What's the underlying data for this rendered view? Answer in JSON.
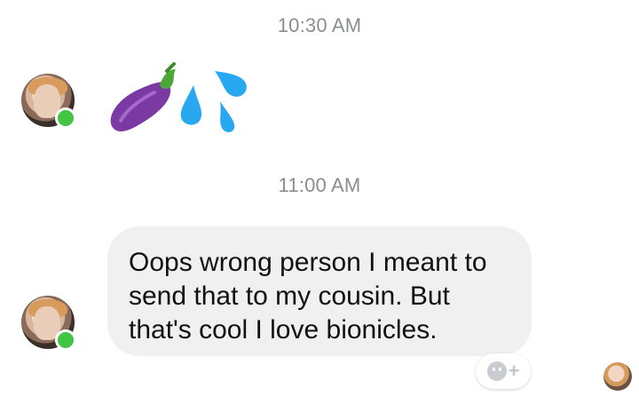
{
  "messages": {
    "time_1": "10:30 AM",
    "time_2": "11:00 AM",
    "message_2_text": "Oops wrong person I meant to send that to my cousin. But that's cool I love bionicles."
  },
  "emoji_message": {
    "icons": [
      "eggplant-icon",
      "sweat-droplets-icon"
    ]
  },
  "sender": {
    "status": "online",
    "presence_color": "#43c544"
  },
  "reaction_button": {
    "label": "+",
    "icon": "smiley-icon"
  },
  "colors": {
    "bubble": "#f0f0f0",
    "timestamp": "#8a8d91",
    "droplet": "#29a8f2",
    "eggplant": "#7b3aa3"
  }
}
